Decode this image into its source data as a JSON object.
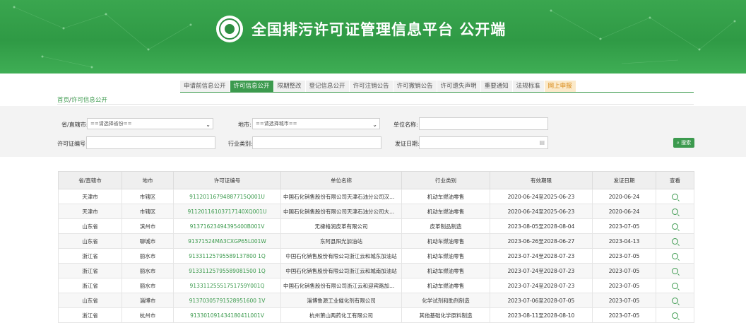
{
  "header": {
    "title": "全国排污许可证管理信息平台  公开端",
    "logo_text": "M.E.E"
  },
  "nav": {
    "tabs": [
      {
        "label": "申请前信息公开",
        "state": ""
      },
      {
        "label": "许可信息公开",
        "state": "active"
      },
      {
        "label": "限期整改",
        "state": ""
      },
      {
        "label": "登记信息公开",
        "state": ""
      },
      {
        "label": "许可注销公告",
        "state": ""
      },
      {
        "label": "许可撤销公告",
        "state": ""
      },
      {
        "label": "许可遗失声明",
        "state": ""
      },
      {
        "label": "重要通知",
        "state": ""
      },
      {
        "label": "法规标准",
        "state": ""
      },
      {
        "label": "网上申报",
        "state": "highlight"
      }
    ]
  },
  "breadcrumb": {
    "home": "首页",
    "sep": "/",
    "current": "许可信息公开"
  },
  "form": {
    "province_label": "省/直辖市:",
    "province_value": "==请选择省份==",
    "city_label": "地市:",
    "city_value": "==请选择城市==",
    "unit_label": "单位名称:",
    "unit_value": "",
    "license_label": "许可证编号:",
    "license_value": "",
    "industry_label": "行业类别:",
    "industry_value": "",
    "date_label": "发证日期:",
    "date_value": "",
    "search_label": "搜索"
  },
  "table": {
    "headers": [
      "省/直辖市",
      "地市",
      "许可证编号",
      "单位名称",
      "行业类别",
      "有效期限",
      "发证日期",
      "查看"
    ],
    "rows": [
      [
        "天津市",
        "市辖区",
        "91120116794887715Q001U",
        "中国石化销售股份有限公司天津石油分公司汉沽两汉路...",
        "机动车燃油零售",
        "2020-06-24至2025-06-23",
        "2020-06-24"
      ],
      [
        "天津市",
        "市辖区",
        "91120116103717140XQ001U",
        "中国石化销售股份有限公司天津石油分公司大港津港路...",
        "机动车燃油零售",
        "2020-06-24至2025-06-23",
        "2020-06-24"
      ],
      [
        "山东省",
        "滨州市",
        "91371623494395400B001V",
        "无棣格润皮革有限公司",
        "皮革制品制造",
        "2023-08-05至2028-08-04",
        "2023-07-05"
      ],
      [
        "山东省",
        "聊城市",
        "91371524MA3CXGP65L001W",
        "东阿县阳光加油站",
        "机动车燃油零售",
        "2023-06-26至2028-06-27",
        "2023-04-13"
      ],
      [
        "浙江省",
        "丽水市",
        "91331125795589137800 1Q",
        "中国石化销售股份有限公司浙江云和城东加油站",
        "机动车燃油零售",
        "2023-07-24至2028-07-23",
        "2023-07-05"
      ],
      [
        "浙江省",
        "丽水市",
        "91331125795589081500 1Q",
        "中国石化销售股份有限公司浙江云和城南加油站",
        "机动车燃油零售",
        "2023-07-24至2028-07-23",
        "2023-07-05"
      ],
      [
        "浙江省",
        "丽水市",
        "91331125551751759Y001Q",
        "中国石化销售股份有限公司浙江云和迎宾路加油站",
        "机动车燃油零售",
        "2023-07-24至2028-07-23",
        "2023-07-05"
      ],
      [
        "山东省",
        "淄博市",
        "91370305791528951600 1V",
        "淄博鲁源工业催化剂有限公司",
        "化学试剂和助剂制造",
        "2023-07-06至2028-07-05",
        "2023-07-05"
      ],
      [
        "浙江省",
        "杭州市",
        "91330109143418041L001V",
        "杭州萧山两药化工有限公司",
        "其他基础化学原料制造",
        "2023-08-11至2028-08-10",
        "2023-07-05"
      ]
    ]
  },
  "colors": {
    "brand": "#3c9a4e",
    "highlight": "#d88a18"
  }
}
